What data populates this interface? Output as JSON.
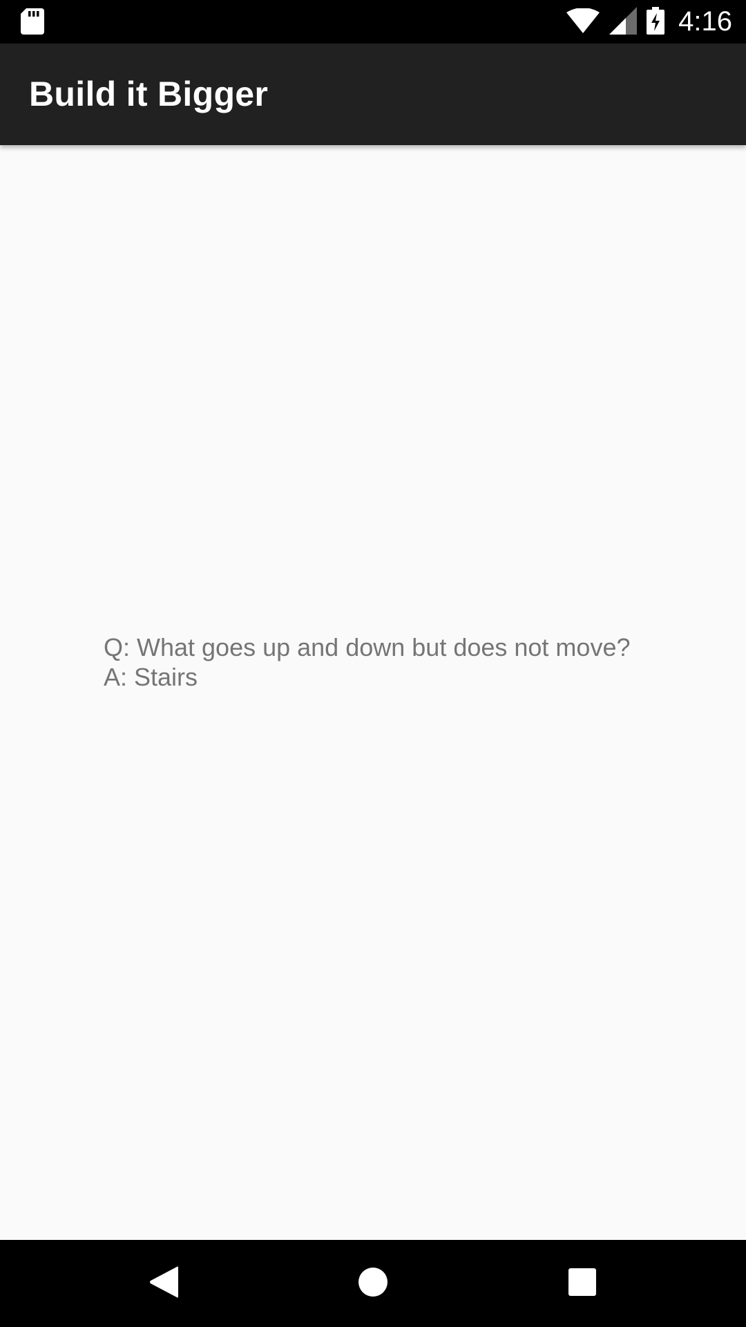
{
  "status_bar": {
    "time": "4:16",
    "icons": [
      "sd-card-icon",
      "wifi-icon",
      "cell-signal-icon",
      "battery-charging-icon"
    ]
  },
  "app_bar": {
    "title": "Build it Bigger"
  },
  "joke": {
    "text": "Q: What goes up and down but does not move?\nA: Stairs"
  },
  "nav_bar": {
    "buttons": [
      "back-icon",
      "home-icon",
      "recents-icon"
    ]
  },
  "colors": {
    "status_bar": "#000000",
    "app_bar": "#212121",
    "background": "#fafafa",
    "text": "#757575",
    "nav_bar": "#000000"
  }
}
